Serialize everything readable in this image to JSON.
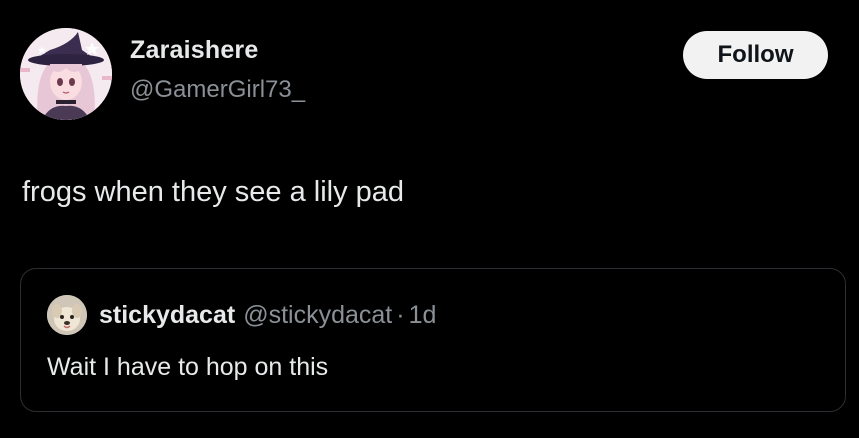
{
  "author": {
    "display_name": "Zaraishere",
    "handle": "@GamerGirl73_",
    "avatar_icon": "anime-girl-witch-hat-avatar"
  },
  "follow_button": {
    "label": "Follow"
  },
  "tweet": {
    "text": "frogs when they see a lily pad"
  },
  "quoted_tweet": {
    "display_name": "stickydacat",
    "handle": "@stickydacat",
    "separator": "·",
    "time": "1d",
    "text": "Wait I have to hop on this",
    "avatar_icon": "dog-avatar"
  },
  "colors": {
    "background": "#000000",
    "primary_text": "#e7e9ea",
    "secondary_text": "#8b9096",
    "button_bg": "#f2f2f2",
    "card_border": "#2b2f33"
  }
}
